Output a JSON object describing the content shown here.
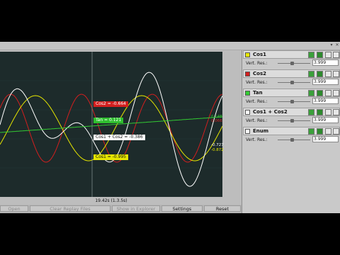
{
  "plot": {
    "cursor_labels": {
      "cos2": "Cos2 = -0.664",
      "tan": "Tan = 0.121",
      "sum": "Cos1 + Cos2 = -0.386",
      "cos1": "Cos1 = -0.995"
    },
    "right_values": {
      "tan_top": "0.148",
      "tan_bot": "0.066",
      "sum_val": "-0.727",
      "cos1_val": "-0.872"
    },
    "time_label": "19.42s (1.3.5s)",
    "colors": {
      "cos1": "#e6e600",
      "cos2": "#d21f1f",
      "tan": "#33cc33",
      "sum": "#ffffff",
      "enum": "#dddddd"
    }
  },
  "buttons": {
    "open": "Open",
    "clear": "Clear Replay Files",
    "show": "Show in Explorer",
    "settings": "Settings",
    "reset": "Reset"
  },
  "channels": [
    {
      "name": "Cos1",
      "vert_res_label": "Vert. Res.:",
      "vert_res_value": "3.999",
      "color": "#e6e600",
      "slider_pos": 0.45
    },
    {
      "name": "Cos2",
      "vert_res_label": "Vert. Res.:",
      "vert_res_value": "3.999",
      "color": "#d21f1f",
      "slider_pos": 0.45
    },
    {
      "name": "Tan",
      "vert_res_label": "Vert. Res.:",
      "vert_res_value": "3.999",
      "color": "#33cc33",
      "slider_pos": 0.45
    },
    {
      "name": "Cos1 + Cos2",
      "vert_res_label": "Vert. Res.:",
      "vert_res_value": "3.999",
      "color": "#ffffff",
      "slider_pos": 0.45
    },
    {
      "name": "Enum",
      "vert_res_label": "Vert. Res.:",
      "vert_res_value": "3.999",
      "color": "#ffffff",
      "slider_pos": 0.45
    }
  ]
}
